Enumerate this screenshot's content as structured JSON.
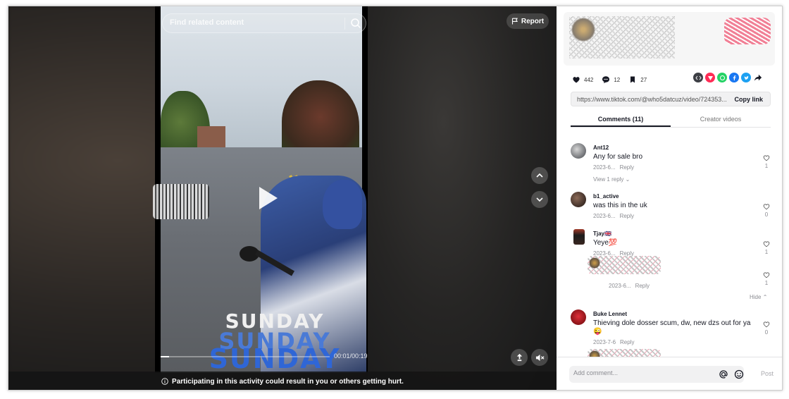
{
  "search": {
    "placeholder": "Find related content"
  },
  "report": {
    "label": "Report"
  },
  "video": {
    "overlay_text": [
      "SUNDAY",
      "SUNDAY",
      "SUNDAY"
    ],
    "time": "00:01/00:19",
    "progress": 0.05
  },
  "warning": {
    "text": "Participating in this activity could result in you or others getting hurt."
  },
  "stats": {
    "likes": "442",
    "comments": "12",
    "saves": "27"
  },
  "share_icons": [
    "embed-icon",
    "tiktok-send-icon",
    "whatsapp-icon",
    "facebook-icon",
    "twitter-icon",
    "forward-arrow-icon"
  ],
  "link": {
    "url": "https://www.tiktok.com/@who5datcuz/video/724353...",
    "copy_label": "Copy link"
  },
  "tabs": [
    {
      "label": "Comments (11)",
      "active": true
    },
    {
      "label": "Creator videos",
      "active": false
    }
  ],
  "comments": [
    {
      "user": "Ant12",
      "text": "Any for sale bro",
      "date": "2023-6...",
      "reply": "Reply",
      "likes": "1",
      "view_replies": "View 1 reply"
    },
    {
      "user": "b1_active",
      "text": "was this in the uk",
      "date": "2023-6...",
      "reply": "Reply",
      "likes": "0"
    },
    {
      "user": "Tjay🇬🇧",
      "text": "Yeye💯",
      "date": "2023-6...",
      "reply": "Reply",
      "likes": "1",
      "sub_reply": {
        "date": "2023-6...",
        "reply": "Reply",
        "likes": "1"
      },
      "hide": "Hide"
    },
    {
      "user": "Buke Lennet",
      "text": "Thieving dole dosser scum, dw, new dzs out for ya 😜",
      "date": "2023-7-6",
      "reply": "Reply",
      "likes": "0"
    }
  ],
  "compose": {
    "placeholder": "Add comment...",
    "post_label": "Post"
  },
  "colors": {
    "accent": "#fe2c55",
    "text": "#161823",
    "muted": "#8a8b91"
  }
}
